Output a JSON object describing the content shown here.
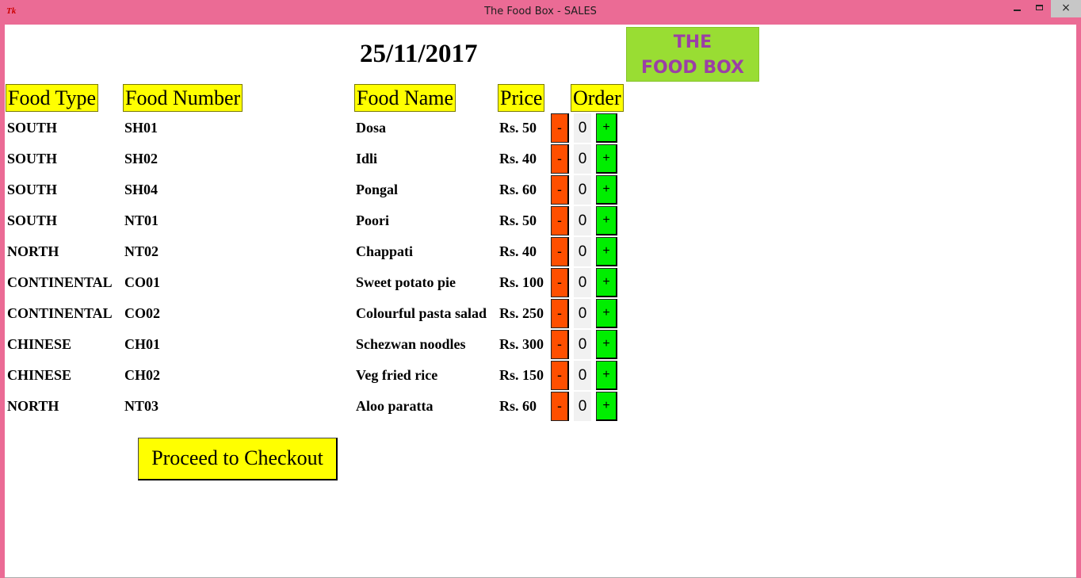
{
  "window": {
    "title": "The Food Box - SALES",
    "icon": "tk-feather-icon",
    "controls": {
      "minimize": "minimize-icon",
      "maximize": "maximize-icon",
      "close": "close-icon",
      "close_glyph": "×"
    }
  },
  "date": "25/11/2017",
  "logo": {
    "line1": "THE",
    "line2": "FOOD BOX"
  },
  "headers": {
    "food_type": "Food Type",
    "food_number": "Food Number",
    "food_name": "Food Name",
    "price": "Price",
    "order": "Order"
  },
  "order_controls": {
    "minus": "-",
    "plus": "+"
  },
  "items": [
    {
      "type": "SOUTH",
      "number": "SH01",
      "name": "Dosa",
      "price": "Rs. 50",
      "qty": "0"
    },
    {
      "type": "SOUTH",
      "number": "SH02",
      "name": "Idli",
      "price": "Rs. 40",
      "qty": "0"
    },
    {
      "type": "SOUTH",
      "number": "SH04",
      "name": "Pongal",
      "price": "Rs. 60",
      "qty": "0"
    },
    {
      "type": "SOUTH",
      "number": "NT01",
      "name": "Poori",
      "price": "Rs. 50",
      "qty": "0"
    },
    {
      "type": "NORTH",
      "number": "NT02",
      "name": "Chappati",
      "price": "Rs. 40",
      "qty": "0"
    },
    {
      "type": "CONTINENTAL",
      "number": "CO01",
      "name": "Sweet potato pie",
      "price": "Rs. 100",
      "qty": "0"
    },
    {
      "type": "CONTINENTAL",
      "number": "CO02",
      "name": "Colourful pasta salad",
      "price": "Rs. 250",
      "qty": "0"
    },
    {
      "type": "CHINESE",
      "number": "CH01",
      "name": "Schezwan noodles",
      "price": "Rs. 300",
      "qty": "0"
    },
    {
      "type": "CHINESE",
      "number": "CH02",
      "name": "Veg fried rice",
      "price": "Rs. 150",
      "qty": "0"
    },
    {
      "type": "NORTH",
      "number": "NT03",
      "name": "Aloo paratta",
      "price": "Rs. 60",
      "qty": "0"
    }
  ],
  "checkout_label": "Proceed to Checkout",
  "colors": {
    "titlebar": "#eb6b95",
    "header_bg": "#ffff00",
    "minus_button": "#ff4f00",
    "plus_button": "#00ee00",
    "logo_bg": "#99dd33",
    "logo_text": "#9b3fa6"
  }
}
